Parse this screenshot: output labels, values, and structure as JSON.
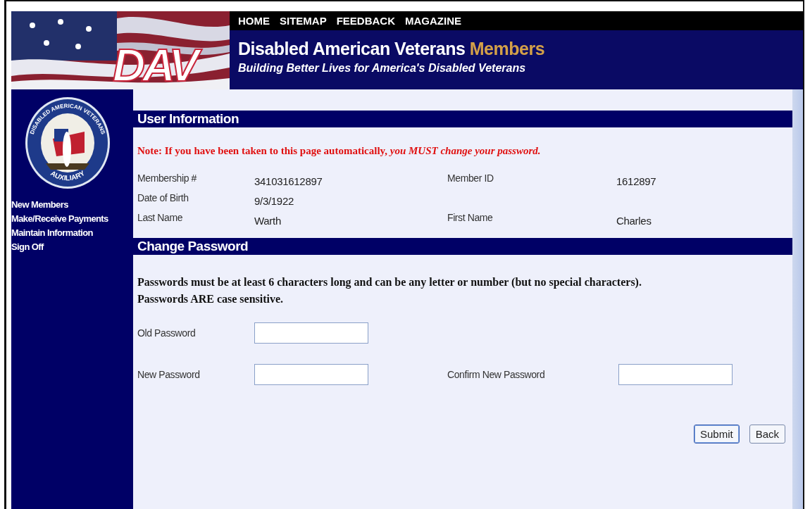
{
  "header": {
    "logo": "DAV",
    "nav": [
      "HOME",
      "SITEMAP",
      "FEEDBACK",
      "MAGAZINE"
    ],
    "title": "Disabled American Veterans",
    "title_highlight": "Members",
    "tagline": "Building Better Lives for America's Disabled Veterans"
  },
  "sidebar": {
    "seal_top": "DISABLED AMERICAN VETERANS",
    "seal_bottom": "AUXILIARY",
    "links": [
      "New Members",
      "Make/Receive Payments",
      "Maintain Information",
      "Sign Off"
    ]
  },
  "user_information": {
    "heading": "User Information",
    "note": "Note: If you have been taken to this page automatically, *you MUST change your password.*",
    "fields": [
      {
        "label": "Membership #",
        "value": "341031612897"
      },
      {
        "label": "Member ID",
        "value": "1612897"
      },
      {
        "label": "Date of Birth",
        "value": "9/3/1922"
      },
      {
        "label": "Last Name",
        "value": "Warth"
      },
      {
        "label": "First Name",
        "value": "Charles"
      }
    ]
  },
  "change_password": {
    "heading": "Change Password",
    "rules": [
      "Passwords must be at least 6 characters long and can be any letter or number (but no special characters).",
      "Passwords ARE case sensitive."
    ],
    "old_password": {
      "label": "Old Password"
    },
    "new_password": {
      "label": "New Password"
    },
    "confirm_password": {
      "label": "Confirm New Password"
    },
    "buttons": [
      "Submit",
      "Back"
    ]
  }
}
